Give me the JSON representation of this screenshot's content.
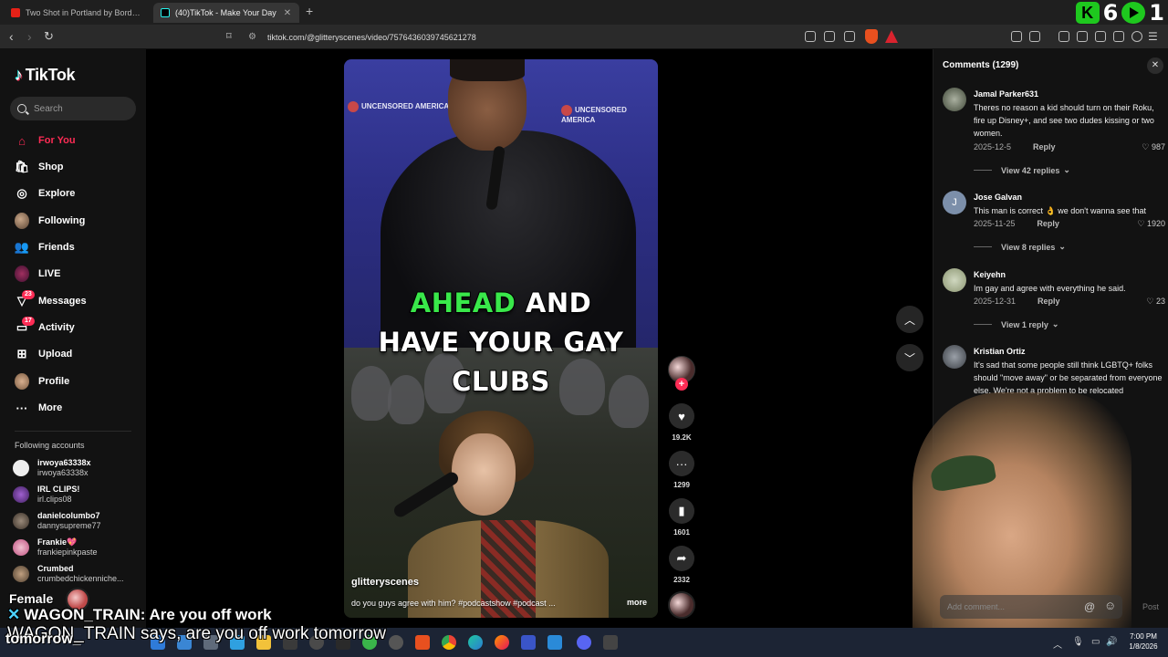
{
  "browser": {
    "tabs": [
      {
        "title": "Two Shot in Portland by Border Patro",
        "active": false
      },
      {
        "title": "(40)TikTok - Make Your Day",
        "active": true
      }
    ],
    "url": "tiktok.com/@glitteryscenes/video/7576436039745621278",
    "stream_widget": {
      "count_a": "6",
      "count_b": "1"
    }
  },
  "sidebar": {
    "brand": "TikTok",
    "search_placeholder": "Search",
    "nav": [
      {
        "label": "For You",
        "icon": "home-icon",
        "active": true
      },
      {
        "label": "Shop",
        "icon": "shop-icon"
      },
      {
        "label": "Explore",
        "icon": "compass-icon"
      },
      {
        "label": "Following",
        "icon": "following-avatar-icon"
      },
      {
        "label": "Friends",
        "icon": "friends-icon"
      },
      {
        "label": "LIVE",
        "icon": "live-icon"
      },
      {
        "label": "Messages",
        "icon": "messages-icon",
        "badge": "23"
      },
      {
        "label": "Activity",
        "icon": "activity-icon",
        "badge": "17"
      },
      {
        "label": "Upload",
        "icon": "upload-icon"
      },
      {
        "label": "Profile",
        "icon": "profile-avatar-icon"
      },
      {
        "label": "More",
        "icon": "more-icon"
      }
    ],
    "following_title": "Following accounts",
    "following": [
      {
        "name": "irwoya63338x",
        "handle": "irwoya63338x"
      },
      {
        "name": "IRL CLIPS!",
        "handle": "irl.clips08"
      },
      {
        "name": "danielcolumbo7",
        "handle": "dannysupreme77"
      },
      {
        "name": "Frankie💖",
        "handle": "frankiepinkpaste"
      },
      {
        "name": "Crumbed",
        "handle": "crumbedchickenniche..."
      }
    ]
  },
  "video": {
    "caption_highlight": "AHEAD",
    "caption_line1_rest": " AND",
    "caption_line2": "HAVE YOUR GAY",
    "caption_line3": "CLUBS",
    "author": "glitteryscenes",
    "description": "do you guys agree with him? #podcastshow #podcast ...",
    "more_label": "more",
    "banner_text": "UNCENSORED AMERICA",
    "likes": "19.2K",
    "comments": "1299",
    "saves": "1601",
    "shares": "2332"
  },
  "comments_panel": {
    "title": "Comments (1299)",
    "add_placeholder": "Add comment...",
    "post_label": "Post",
    "items": [
      {
        "name": "Jamal Parker631",
        "text": "Theres no reason a kid should turn on their Roku, fire up Disney+, and see two dudes kissing or two women.",
        "date": "2025-12-5",
        "reply": "Reply",
        "likes": "987",
        "views": "View 42 replies"
      },
      {
        "name": "Jose Galvan",
        "text": "This man is correct 👌 we don't wanna see that",
        "date": "2025-11-25",
        "reply": "Reply",
        "likes": "1920",
        "views": "View 8 replies"
      },
      {
        "name": "Keiyehn",
        "text": "Im gay and agree with everything he said.",
        "date": "2025-12-31",
        "reply": "Reply",
        "likes": "23",
        "views": "View 1 reply"
      },
      {
        "name": "Kristian Ortiz",
        "text": "It's sad that some people still think LGBTQ+ folks should \"move away\" or be separated from everyone else. We're not a problem to be relocated",
        "date": "",
        "reply": "",
        "likes": "",
        "views": ""
      }
    ]
  },
  "overlay": {
    "female_label": "Female",
    "chat_user": "WAGON_TRAIN:",
    "chat_message": " Are you off work",
    "tts_line": "WAGON_TRAIN says, are you off work tomorrow",
    "tomorrow": "tomorrow_"
  },
  "taskbar": {
    "time": "7:00 PM",
    "date": "1/8/2026"
  }
}
